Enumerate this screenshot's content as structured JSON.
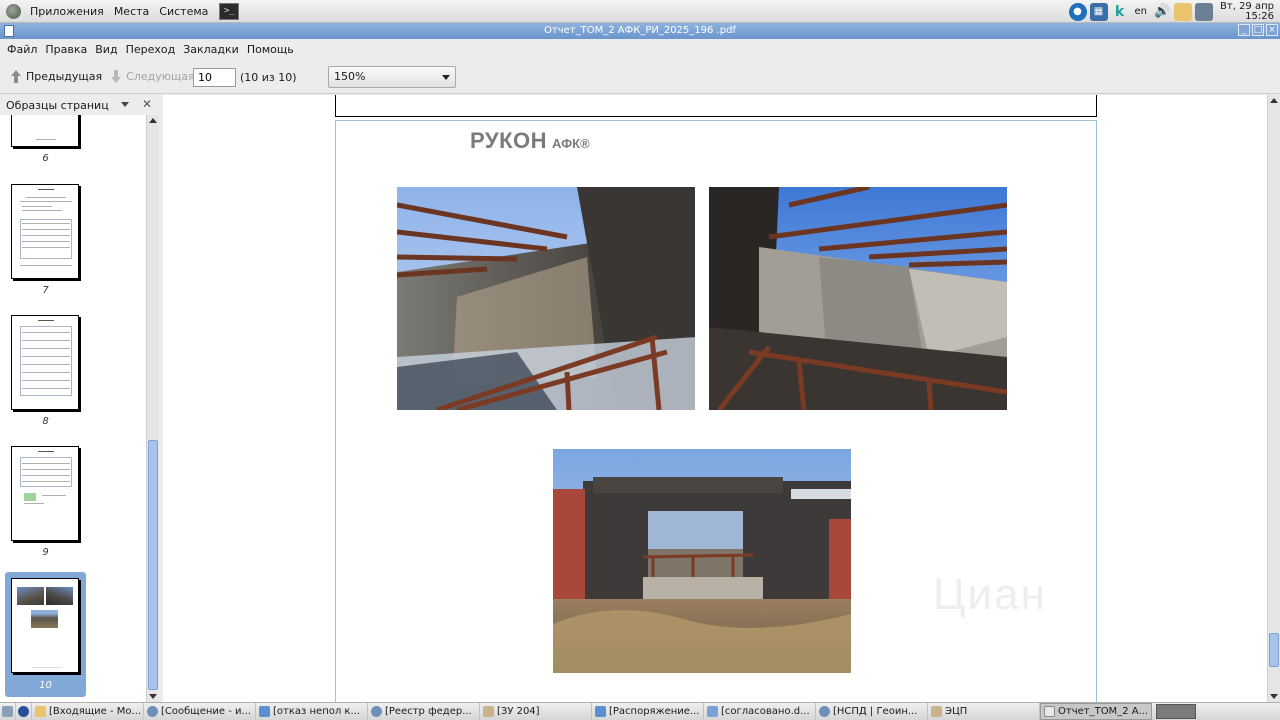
{
  "panel": {
    "menus": [
      "Приложения",
      "Места",
      "Система"
    ],
    "lang": "en",
    "clock_date": "Вт, 29 апр",
    "clock_time": "15:26"
  },
  "window": {
    "title": "Отчет_ТОМ_2 АФК_РИ_2025_196 .pdf"
  },
  "menubar": [
    "Файл",
    "Правка",
    "Вид",
    "Переход",
    "Закладки",
    "Помощь"
  ],
  "toolbar": {
    "prev_label": "Предыдущая",
    "next_label": "Следующая",
    "page_value": "10",
    "page_count": "(10 из 10)",
    "zoom": "150%"
  },
  "sidebar": {
    "title": "Образцы страниц",
    "thumbs": [
      {
        "label": "6"
      },
      {
        "label": "7"
      },
      {
        "label": "8"
      },
      {
        "label": "9"
      },
      {
        "label": "10"
      }
    ]
  },
  "document": {
    "logo_main": "РУКОН",
    "logo_sub": "АФК®",
    "watermark": "Циан"
  },
  "taskbar": {
    "tasks": [
      {
        "label": "[Входящие - Мо...",
        "icon": "folder-icon"
      },
      {
        "label": "[Сообщение - и...",
        "icon": "yandex-browser-icon"
      },
      {
        "label": "[отказ непол к...",
        "icon": "writer-doc-icon"
      },
      {
        "label": "[Реестр федер...",
        "icon": "yandex-browser-icon"
      },
      {
        "label": "[ЗУ 204]",
        "icon": "folder-icon"
      },
      {
        "label": "[Распоряжение...",
        "icon": "writer-doc-icon"
      },
      {
        "label": "[согласовано.d...",
        "icon": "writer-doc-icon"
      },
      {
        "label": "[НСПД | Геоин...",
        "icon": "yandex-browser-icon"
      },
      {
        "label": "ЭЦП",
        "icon": "folder-icon"
      },
      {
        "label": "Отчет_ТОМ_2 А...",
        "icon": "pdf-doc-icon"
      }
    ]
  }
}
